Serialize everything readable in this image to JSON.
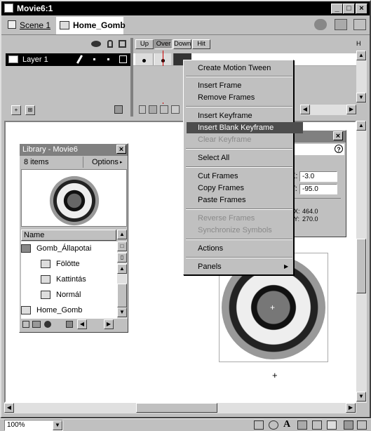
{
  "window": {
    "title": "Movie6:1"
  },
  "edit_bar": {
    "scene_label": "Scene 1",
    "symbol_label": "Home_Gomb"
  },
  "timeline": {
    "layer_name": "Layer 1",
    "frame_labels": [
      "Up",
      "Over",
      "Down",
      "Hit"
    ]
  },
  "context_menu": {
    "items": [
      {
        "label": "Create Motion Tween",
        "enabled": true
      },
      {
        "label": "Insert Frame",
        "enabled": true
      },
      {
        "label": "Remove Frames",
        "enabled": true
      },
      {
        "label": "Insert Keyframe",
        "enabled": true
      },
      {
        "label": "Insert Blank Keyframe",
        "enabled": true,
        "highlighted": true
      },
      {
        "label": "Clear Keyframe",
        "enabled": false
      },
      {
        "label": "Select All",
        "enabled": true
      },
      {
        "label": "Cut Frames",
        "enabled": true
      },
      {
        "label": "Copy Frames",
        "enabled": true
      },
      {
        "label": "Paste Frames",
        "enabled": true
      },
      {
        "label": "Reverse Frames",
        "enabled": false
      },
      {
        "label": "Synchronize Symbols",
        "enabled": false
      },
      {
        "label": "Actions",
        "enabled": true
      },
      {
        "label": "Panels",
        "enabled": true,
        "submenu": true
      }
    ]
  },
  "library": {
    "title": "Library - Movie6",
    "count_label": "8 items",
    "options_label": "Options",
    "column_name": "Name",
    "items": [
      {
        "label": "Gomb_Állapotai",
        "icon": "folder-icon"
      },
      {
        "label": "Fölötte",
        "icon": "graphic-symbol-icon"
      },
      {
        "label": "Kattintás",
        "icon": "graphic-symbol-icon"
      },
      {
        "label": "Normál",
        "icon": "graphic-symbol-icon"
      },
      {
        "label": "Home_Gomb",
        "icon": "button-symbol-icon"
      }
    ]
  },
  "info_panel": {
    "field_x_label": "X:",
    "field_x": "-3.0",
    "field_y_label": "Y:",
    "field_y": "-95.0",
    "coord_x_label": "X:",
    "coord_x": "464.0",
    "coord_y_label": "Y:",
    "coord_y": "270.0",
    "help": "?"
  },
  "status_bar": {
    "zoom": "100%"
  }
}
